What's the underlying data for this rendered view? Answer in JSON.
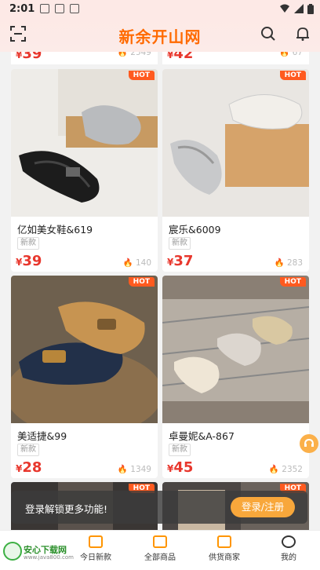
{
  "status": {
    "time": "2:01"
  },
  "header": {
    "logo_text": "新余开山网"
  },
  "previous_row": [
    {
      "price": "39",
      "heat": "2549"
    },
    {
      "price": "42",
      "heat": "67"
    }
  ],
  "products": [
    {
      "name": "亿如美女鞋&619",
      "tag": "新款",
      "price": "39",
      "heat": "140",
      "hot": "HOT",
      "palette": "dark"
    },
    {
      "name": "宸乐&6009",
      "tag": "新款",
      "price": "37",
      "heat": "283",
      "hot": "HOT",
      "palette": "silver"
    },
    {
      "name": "美适捷&99",
      "tag": "新款",
      "price": "28",
      "heat": "1349",
      "hot": "HOT",
      "palette": "navy"
    },
    {
      "name": "卓曼妮&A-867",
      "tag": "新款",
      "price": "45",
      "heat": "2352",
      "hot": "HOT",
      "palette": "gold"
    },
    {
      "hot": "HOT"
    },
    {
      "hot": "HOT"
    }
  ],
  "currency": "¥",
  "login_banner": {
    "text": "登录解锁更多功能!",
    "button": "登录/注册"
  },
  "tabbar": [
    {
      "label": "今日新款",
      "icon": "new-icon"
    },
    {
      "label": "全部商品",
      "icon": "shopping-bag-icon"
    },
    {
      "label": "供货商家",
      "icon": "store-icon"
    },
    {
      "label": "我的",
      "icon": "user-icon"
    }
  ],
  "watermark": {
    "title": "安心下载网",
    "sub": "www.java800.com"
  },
  "colors": {
    "accent": "#ff6a00",
    "price": "#e8372d",
    "login_btn": "#f8a73b"
  }
}
